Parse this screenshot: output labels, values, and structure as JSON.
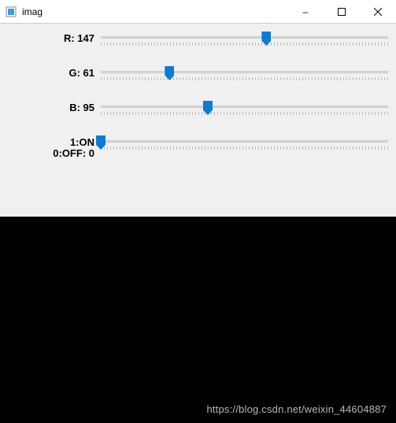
{
  "window": {
    "title": "imag",
    "buttons": {
      "min": "–",
      "max": "□",
      "close": "✕"
    }
  },
  "sliders": {
    "max": 255,
    "r": {
      "label_prefix": "R: ",
      "value": 147
    },
    "g": {
      "label_prefix": "G: ",
      "value": 61
    },
    "b": {
      "label_prefix": "B: ",
      "value": 95
    },
    "switch": {
      "label_line1": "1:ON",
      "label_line2_prefix": "0:OFF: ",
      "value": 0,
      "max": 1
    }
  },
  "watermark": "https://blog.csdn.net/weixin_44604887"
}
